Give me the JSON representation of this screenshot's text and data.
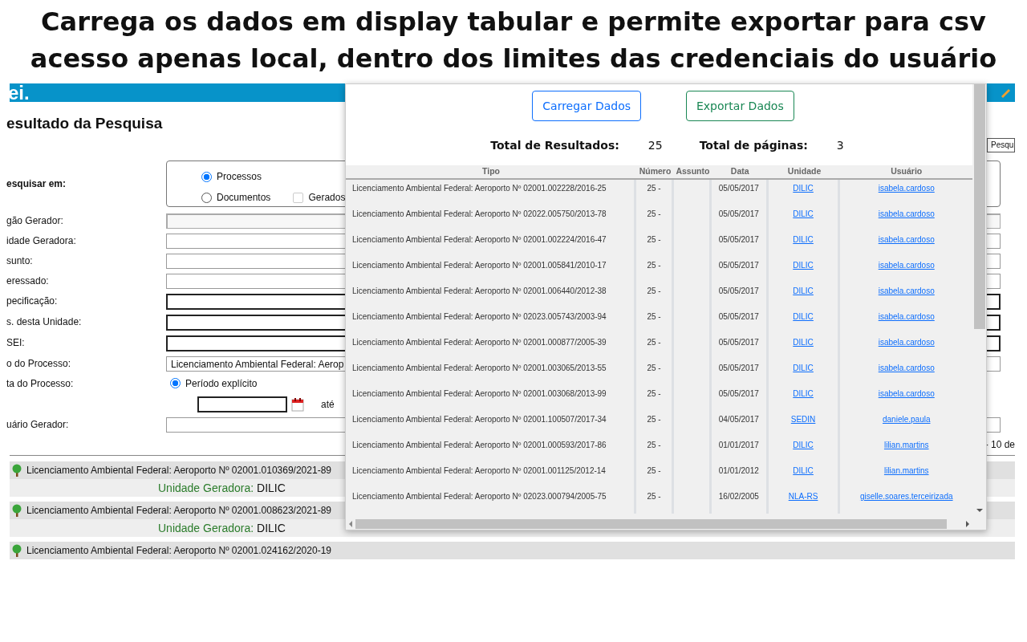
{
  "banner": {
    "lines": [
      "Carrega os dados em display tabular e permite exportar para csv",
      "acesso apenas local, dentro dos limites das credenciais do usuário"
    ]
  },
  "header": {
    "logo": "ei."
  },
  "page": {
    "title": "esultado da Pesquisa",
    "search_button": "Pesqu",
    "search_in": {
      "label": "esquisar em:",
      "options": [
        {
          "label": "Processos",
          "selected": true
        },
        {
          "label": "Documentos",
          "selected": false
        }
      ],
      "generated": {
        "label": "Gerados",
        "checked": false
      }
    },
    "fields": [
      {
        "label": "gão Gerador:",
        "kind": "disabled"
      },
      {
        "label": "idade Geradora:",
        "kind": "text"
      },
      {
        "label": "sunto:",
        "kind": "text"
      },
      {
        "label": "eressado:",
        "kind": "text"
      },
      {
        "label": "pecificação:",
        "kind": "strong"
      },
      {
        "label": "s. desta Unidade:",
        "kind": "strong"
      },
      {
        "label": "SEI:",
        "kind": "strong"
      },
      {
        "label": "o do Processo:",
        "kind": "select",
        "value": "Licenciamento Ambiental Federal: Aerop"
      },
      {
        "label": "ta do Processo:",
        "kind": "period",
        "option": {
          "label": "Período explícito",
          "selected": true
        },
        "until": "até"
      },
      {
        "label": "uário Gerador:",
        "kind": "text"
      }
    ],
    "pager": "- 10 de",
    "results": [
      {
        "title": "Licenciamento Ambiental Federal: Aeroporto Nº 02001.010369/2021-89",
        "unit_label": "Unidade Geradora:",
        "unit": "DILIC"
      },
      {
        "title": "Licenciamento Ambiental Federal: Aeroporto Nº 02001.008623/2021-89",
        "unit_label": "Unidade Geradora:",
        "unit": "DILIC"
      },
      {
        "title": "Licenciamento Ambiental Federal: Aeroporto Nº 02001.024162/2020-19"
      }
    ]
  },
  "popup": {
    "buttons": [
      {
        "label": "Carregar Dados",
        "kind": "primary"
      },
      {
        "label": "Exportar Dados",
        "kind": "success"
      }
    ],
    "totals": [
      {
        "label": "Total de Resultados:",
        "value": "25"
      },
      {
        "label": "Total de páginas:",
        "value": "3"
      }
    ],
    "table": {
      "columns": [
        "Tipo",
        "Número",
        "Assunto",
        "Data",
        "Unidade",
        "Usuário"
      ],
      "rows": [
        {
          "tipo": "Licenciamento Ambiental Federal: Aeroporto Nº 02001.002228/2016-25",
          "numero": "25 -",
          "data": "05/05/2017",
          "unidade": "DILIC",
          "usuario": "isabela.cardoso"
        },
        {
          "tipo": "Licenciamento Ambiental Federal: Aeroporto Nº 02022.005750/2013-78",
          "numero": "25 -",
          "data": "05/05/2017",
          "unidade": "DILIC",
          "usuario": "isabela.cardoso"
        },
        {
          "tipo": "Licenciamento Ambiental Federal: Aeroporto Nº 02001.002224/2016-47",
          "numero": "25 -",
          "data": "05/05/2017",
          "unidade": "DILIC",
          "usuario": "isabela.cardoso"
        },
        {
          "tipo": "Licenciamento Ambiental Federal: Aeroporto Nº 02001.005841/2010-17",
          "numero": "25 -",
          "data": "05/05/2017",
          "unidade": "DILIC",
          "usuario": "isabela.cardoso"
        },
        {
          "tipo": "Licenciamento Ambiental Federal: Aeroporto Nº 02001.006440/2012-38",
          "numero": "25 -",
          "data": "05/05/2017",
          "unidade": "DILIC",
          "usuario": "isabela.cardoso"
        },
        {
          "tipo": "Licenciamento Ambiental Federal: Aeroporto Nº 02023.005743/2003-94",
          "numero": "25 -",
          "data": "05/05/2017",
          "unidade": "DILIC",
          "usuario": "isabela.cardoso"
        },
        {
          "tipo": "Licenciamento Ambiental Federal: Aeroporto Nº 02001.000877/2005-39",
          "numero": "25 -",
          "data": "05/05/2017",
          "unidade": "DILIC",
          "usuario": "isabela.cardoso"
        },
        {
          "tipo": "Licenciamento Ambiental Federal: Aeroporto Nº 02001.003065/2013-55",
          "numero": "25 -",
          "data": "05/05/2017",
          "unidade": "DILIC",
          "usuario": "isabela.cardoso"
        },
        {
          "tipo": "Licenciamento Ambiental Federal: Aeroporto Nº 02001.003068/2013-99",
          "numero": "25 -",
          "data": "05/05/2017",
          "unidade": "DILIC",
          "usuario": "isabela.cardoso"
        },
        {
          "tipo": "Licenciamento Ambiental Federal: Aeroporto Nº 02001.100507/2017-34",
          "numero": "25 -",
          "data": "04/05/2017",
          "unidade": "SEDIN",
          "usuario": "daniele.paula"
        },
        {
          "tipo": "Licenciamento Ambiental Federal: Aeroporto Nº 02001.000593/2017-86",
          "numero": "25 -",
          "data": "01/01/2017",
          "unidade": "DILIC",
          "usuario": "lilian.martins"
        },
        {
          "tipo": "Licenciamento Ambiental Federal: Aeroporto Nº 02001.001125/2012-14",
          "numero": "25 -",
          "data": "01/01/2012",
          "unidade": "DILIC",
          "usuario": "lilian.martins"
        },
        {
          "tipo": "Licenciamento Ambiental Federal: Aeroporto Nº 02023.000794/2005-75",
          "numero": "25 -",
          "data": "16/02/2005",
          "unidade": "NLA-RS",
          "usuario": "giselle.soares.terceirizada"
        }
      ]
    }
  }
}
